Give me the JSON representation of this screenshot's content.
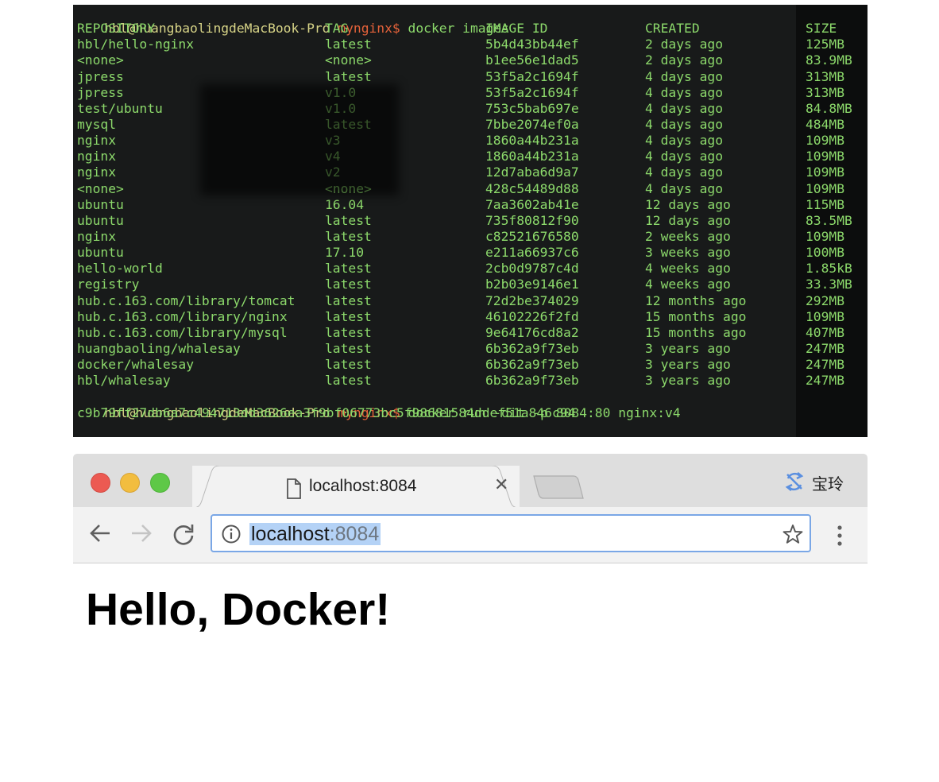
{
  "terminal": {
    "prompt_user": "hbl@huangbaolingdeMacBook-Pro",
    "prompt_dir": "mynginx$",
    "command1": "docker images",
    "headers": {
      "repository": "REPOSITORY",
      "tag": "TAG",
      "image_id": "IMAGE ID",
      "created": "CREATED",
      "size": "SIZE"
    },
    "images": [
      {
        "repository": "hbl/hello-nginx",
        "tag": "latest",
        "image_id": "5b4d43bb44ef",
        "created": "2 days ago",
        "size": "125MB"
      },
      {
        "repository": "<none>",
        "tag": "<none>",
        "image_id": "b1ee56e1dad5",
        "created": "2 days ago",
        "size": "83.9MB"
      },
      {
        "repository": "jpress",
        "tag": "latest",
        "image_id": "53f5a2c1694f",
        "created": "4 days ago",
        "size": "313MB"
      },
      {
        "repository": "jpress",
        "tag": "v1.0",
        "image_id": "53f5a2c1694f",
        "created": "4 days ago",
        "size": "313MB"
      },
      {
        "repository": "test/ubuntu",
        "tag": "v1.0",
        "image_id": "753c5bab697e",
        "created": "4 days ago",
        "size": "84.8MB"
      },
      {
        "repository": "mysql",
        "tag": "latest",
        "image_id": "7bbe2074ef0a",
        "created": "4 days ago",
        "size": "484MB"
      },
      {
        "repository": "nginx",
        "tag": "v3",
        "image_id": "1860a44b231a",
        "created": "4 days ago",
        "size": "109MB"
      },
      {
        "repository": "nginx",
        "tag": "v4",
        "image_id": "1860a44b231a",
        "created": "4 days ago",
        "size": "109MB"
      },
      {
        "repository": "nginx",
        "tag": "v2",
        "image_id": "12d7aba6d9a7",
        "created": "4 days ago",
        "size": "109MB"
      },
      {
        "repository": "<none>",
        "tag": "<none>",
        "image_id": "428c54489d88",
        "created": "4 days ago",
        "size": "109MB"
      },
      {
        "repository": "ubuntu",
        "tag": "16.04",
        "image_id": "7aa3602ab41e",
        "created": "12 days ago",
        "size": "115MB"
      },
      {
        "repository": "ubuntu",
        "tag": "latest",
        "image_id": "735f80812f90",
        "created": "12 days ago",
        "size": "83.5MB"
      },
      {
        "repository": "nginx",
        "tag": "latest",
        "image_id": "c82521676580",
        "created": "2 weeks ago",
        "size": "109MB"
      },
      {
        "repository": "ubuntu",
        "tag": "17.10",
        "image_id": "e211a66937c6",
        "created": "3 weeks ago",
        "size": "100MB"
      },
      {
        "repository": "hello-world",
        "tag": "latest",
        "image_id": "2cb0d9787c4d",
        "created": "4 weeks ago",
        "size": "1.85kB"
      },
      {
        "repository": "registry",
        "tag": "latest",
        "image_id": "b2b03e9146e1",
        "created": "4 weeks ago",
        "size": "33.3MB"
      },
      {
        "repository": "hub.c.163.com/library/tomcat",
        "tag": "latest",
        "image_id": "72d2be374029",
        "created": "12 months ago",
        "size": "292MB"
      },
      {
        "repository": "hub.c.163.com/library/nginx",
        "tag": "latest",
        "image_id": "46102226f2fd",
        "created": "15 months ago",
        "size": "109MB"
      },
      {
        "repository": "hub.c.163.com/library/mysql",
        "tag": "latest",
        "image_id": "9e64176cd8a2",
        "created": "15 months ago",
        "size": "407MB"
      },
      {
        "repository": "huangbaoling/whalesay",
        "tag": "latest",
        "image_id": "6b362a9f73eb",
        "created": "3 years ago",
        "size": "247MB"
      },
      {
        "repository": "docker/whalesay",
        "tag": "latest",
        "image_id": "6b362a9f73eb",
        "created": "3 years ago",
        "size": "247MB"
      },
      {
        "repository": "hbl/whalesay",
        "tag": "latest",
        "image_id": "6b362a9f73eb",
        "created": "3 years ago",
        "size": "247MB"
      }
    ],
    "command2": "docker run -dit -p 8084:80 nginx:v4",
    "output2": "c9b79ff27db6a7c494713dd3626ea3f9bf06773bc5f98681584ddef51a846c94",
    "colors": {
      "background": "#181a1a",
      "text": "#8cd96b",
      "user": "#d7d487",
      "dir": "#e5623a"
    }
  },
  "browser": {
    "tab": {
      "title": "localhost:8084"
    },
    "profile_name": "宝玲",
    "url": {
      "host": "localhost",
      "port": ":8084"
    },
    "page": {
      "heading": "Hello, Docker!"
    },
    "colors": {
      "omnibox_border": "#7aa7e6",
      "selection": "#b4d2f6"
    }
  }
}
